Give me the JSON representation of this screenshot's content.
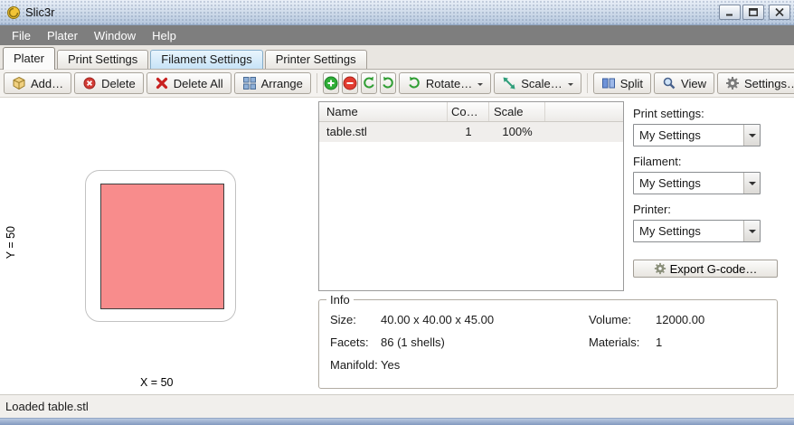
{
  "window": {
    "title": "Slic3r"
  },
  "menu": {
    "items": [
      {
        "label": "File"
      },
      {
        "label": "Plater"
      },
      {
        "label": "Window"
      },
      {
        "label": "Help"
      }
    ]
  },
  "tabs": [
    {
      "label": "Plater",
      "state": "active"
    },
    {
      "label": "Print Settings",
      "state": "normal"
    },
    {
      "label": "Filament Settings",
      "state": "highlighted"
    },
    {
      "label": "Printer Settings",
      "state": "normal"
    }
  ],
  "toolbar": {
    "buttons": {
      "add": "Add…",
      "delete": "Delete",
      "delete_all": "Delete All",
      "arrange": "Arrange",
      "rotate": "Rotate…",
      "scale": "Scale…",
      "split": "Split",
      "view": "View",
      "settings": "Settings…"
    }
  },
  "plater": {
    "y_axis_label": "Y = 50",
    "x_axis_label": "X = 50",
    "object_color": "#f88c8c"
  },
  "object_table": {
    "columns": [
      "Name",
      "Co…",
      "Scale"
    ],
    "rows": [
      {
        "name": "table.stl",
        "copies": "1",
        "scale": "100%"
      }
    ]
  },
  "side_panel": {
    "print_settings_label": "Print settings:",
    "print_settings_value": "My Settings",
    "filament_label": "Filament:",
    "filament_value": "My Settings",
    "printer_label": "Printer:",
    "printer_value": "My Settings",
    "export_gcode_label": "Export G-code…"
  },
  "info": {
    "title": "Info",
    "size_label": "Size:",
    "size_value": "40.00 x 40.00 x 45.00",
    "volume_label": "Volume:",
    "volume_value": "12000.00",
    "facets_label": "Facets:",
    "facets_value": "86 (1 shells)",
    "materials_label": "Materials:",
    "materials_value": "1",
    "manifold_label": "Manifold:",
    "manifold_value": "Yes"
  },
  "status_bar": {
    "text": "Loaded table.stl"
  },
  "icons": {
    "app": "slic3r-logo",
    "minimize": "window-minimize",
    "maximize": "window-maximize",
    "close": "window-close",
    "add": "yellow-cube",
    "delete": "red-circle-x",
    "delete_all": "red-x",
    "arrange": "grid-squares",
    "increase_copies": "green-plus-circle",
    "decrease_copies": "red-minus-circle",
    "rotate_ccw": "green-arrow-ccw",
    "rotate_cw": "green-arrow-cw",
    "scale": "diagonal-resize-arrows",
    "split": "split-squares",
    "view": "magnifier",
    "settings": "gear",
    "export": "gear",
    "combo_arrow": "triangle-down"
  },
  "colors": {
    "object_fill": "#f88c8c",
    "tab_highlight": "#c7e3f7",
    "icon_green": "#2f9e33",
    "icon_red": "#d23b35",
    "menubar_gray": "#7e7e7e",
    "titlebar_top": "#eaf0f8",
    "titlebar_bottom": "#b5c7dd"
  }
}
